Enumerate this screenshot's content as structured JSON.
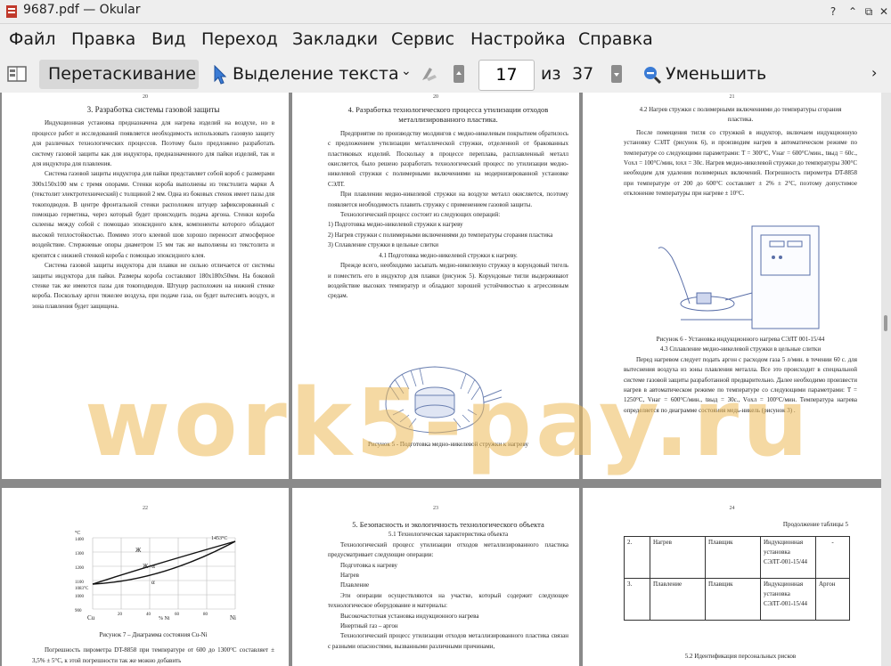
{
  "window": {
    "title": "9687.pdf — Okular",
    "help_button": "?",
    "minimize_button": "⌃",
    "maximize_button": "⧉",
    "close_button": "✕"
  },
  "menu": [
    "Файл",
    "Правка",
    "Вид",
    "Переход",
    "Закладки",
    "Сервис",
    "Настройка",
    "Справка"
  ],
  "toolbar": {
    "drag_label": "Перетаскивание",
    "select_text_label": "Выделение текста",
    "current_page": "17",
    "of_label": "из",
    "total_pages": "37",
    "zoom_out_label": "Уменьшить"
  },
  "watermark": "work5-pay.ru",
  "pages": {
    "p20": {
      "num": "20",
      "heading": "3. Разработка системы газовой защиты",
      "paragraphs": [
        "Индукционная установка предназначена для нагрева изделий на воздухе, но в процессе работ и исследований появляется необходимость использовать газовую защиту для различных технологических процессов. Поэтому было предложено разработать систему газовой защиты как для индуктора, предназначенного для пайки изделий, так и для индуктора для плавления.",
        "Система газовой защиты индуктора для пайки представляет собой короб с размерами 300х150х100 мм с тремя опорами. Стенки короба выполнены из текстолита марки А (текстолит электротехнический) с толщиной 2 мм. Одна из боковых стенок имеет пазы для токоподводов. В центре фронтальной стенки расположен штуцер зафиксированный с помощью герметика, через который будет происходить подача аргона. Стенки короба склеены между собой с помощью эпоксидного клея, компоненты которого обладают высокой теплостойкостью. Помимо этого клеевой шов хорошо переносит атмосферное воздействие. Стержневые опоры диаметром 15 мм так же выполнены из текстолита и крепятся с нижней стенкой короба с помощью эпоксидного клея.",
        "Система газовой защиты индуктора для плавки не сильно отличается от системы защиты индуктора для пайки. Размеры короба составляют 180х180х50мм. На боковой стенке так же имеются пазы для токоподводов. Штуцер расположен на нижней стенке короба. Поскольку аргон тяжелее воздуха, при подаче газа, он будет вытеснять воздух, и зона плавления будет защищена."
      ]
    },
    "p21": {
      "num": "20",
      "heading1": "4. Разработка технологического процесса утилизации отходов",
      "heading2": "металлизированного пластика.",
      "paragraphs": [
        "Предприятие по производству молдингов с медно-никелевым покрытием обратилось с предложением утилизации металлической стружки, отделенной от бракованных пластиковых изделий. Поскольку в процессе переплава, расплавленный металл окисляется, было решено разработать технологический процесс по утилизации медно-никелевой стружки с полимерными включениями на модернизированной установке СЭЛТ.",
        "При плавлении медно-никелевой стружки на воздухе металл окисляется, поэтому появляется необходимость плавить стружку с применением газовой защиты.",
        "Технологический процесс состоит из следующих операций:"
      ],
      "list": [
        "1)  Подготовка медно-никелевой стружки к нагреву",
        "2)  Нагрев стружки с полимерными включениями до температуры сгорания пластика",
        "3)  Сплавление стружки в цельные слитки"
      ],
      "sub": "4.1 Подготовка медно-никелевой стружки к нагреву.",
      "para2": "Прежде всего, необходимо засыпать медно-никелевую стружку в корундовый тигель и поместить его в индуктор для плавки (рисунок 5). Корундовые тигли выдерживают воздействие высоких температур и обладают хорошей устойчивостью к агрессивным средам.",
      "caption": "Рисунок 5 - Подготовка медно-никелевой стружки к нагреву"
    },
    "p22": {
      "num": "21",
      "heading1": "4.2 Нагрев стружки с полимерными включениями до температуры сгорания",
      "heading2": "пластика.",
      "para1": "После помещения тигля со стружкой в индуктор, включаем индукционную установку СЭЛТ (рисунок 6), и производим нагрев в автоматическом режиме по температуре со следующими параметрами: T = 300°C, Vнаг = 600°C/мин., tвыд = 60с., Vохл = 100°C/мин, tохл = 30с. Нагрев медно-никелевой стружки до температуры 300°C необходим для удаления полимерных включений. Погрешность пирометра DT-8858 при температуре от 200 до 600°C составляет ± 2% ± 2°C, поэтому допустимое отклонение температуры при нагреве ± 10°C.",
      "caption": "Рисунок 6 - Установка индукционного нагрева СЭЛТ 001-15/44",
      "sub": "4.3 Сплавление медно-никелевой стружки в цельные слитки",
      "para2": "Перед нагревом следует подать аргон с расходом газа 5 л/мин. в течении 60 с. для вытеснения воздуха из зоны плавления металла. Все это происходит в специальной системе газовой защиты разработанной предварительно. Далее необходимо произвести нагрев в автоматическом режиме по температуре со следующими параметрами: T = 1250°C, Vнаг = 600°C/мин., tвыд = 30с., Vохл = 100°C/мин. Температура нагрева определяется по диаграмме состояния медь-никель (рисунок 3) ."
    },
    "p23": {
      "num": "22",
      "chart_labels": {
        "y_unit": "°C",
        "y_ticks": [
          "1400",
          "1300",
          "1200",
          "1100",
          "1000",
          "900"
        ],
        "x_left": "Cu",
        "x_right": "Ni",
        "x_mid": "% Ni",
        "x_ticks": [
          "20",
          "40",
          "60",
          "80"
        ],
        "top_right": "1453°C",
        "left_temp": "1083°C",
        "phase_liquid": "Ж",
        "phase_mix": "Ж+α",
        "phase_alpha": "α"
      },
      "caption": "Рисунок 7 – Диаграмма состояния Cu-Ni",
      "para": "Погрешность пирометра DT-8858 при температуре от 600 до 1300°C составляет ± 3,5% ± 5°C, к этой погрешности так же можно добавить"
    },
    "p24": {
      "num": "23",
      "heading": "5. Безопасность и экологичность технологического объекта",
      "sub": "5.1 Технологическая характеристика объекта",
      "para1": "Технологический процесс утилизации отходов металлизированного пластика предусматривает следующие операции:",
      "ops": [
        "Подготовка к нагреву",
        "Нагрев",
        "Плавление"
      ],
      "para2": "Эти операции осуществляются на участке, который содержит следующее технологическое оборудование и материалы:",
      "equip": [
        "Высокочастотная установка индукционного нагрева",
        "Инертный газ – аргон"
      ],
      "para3": "Технологический процесс утилизации отходов металлизированного пластика связан с разными опасностями, вызванными различными причинами,"
    },
    "p25": {
      "num": "24",
      "cont": "Продолжение таблицы 5",
      "rows": [
        [
          "2.",
          "Нагрев",
          "Плавщик",
          "Индукционная установка СЭЛТ-001-15/44",
          "-"
        ],
        [
          "3.",
          "Плавление",
          "Плавщик",
          "Индукционная установка СЭЛТ-001-15/44",
          "Аргон"
        ]
      ],
      "sub": "5.2 Идентификация персональных рисков"
    }
  }
}
